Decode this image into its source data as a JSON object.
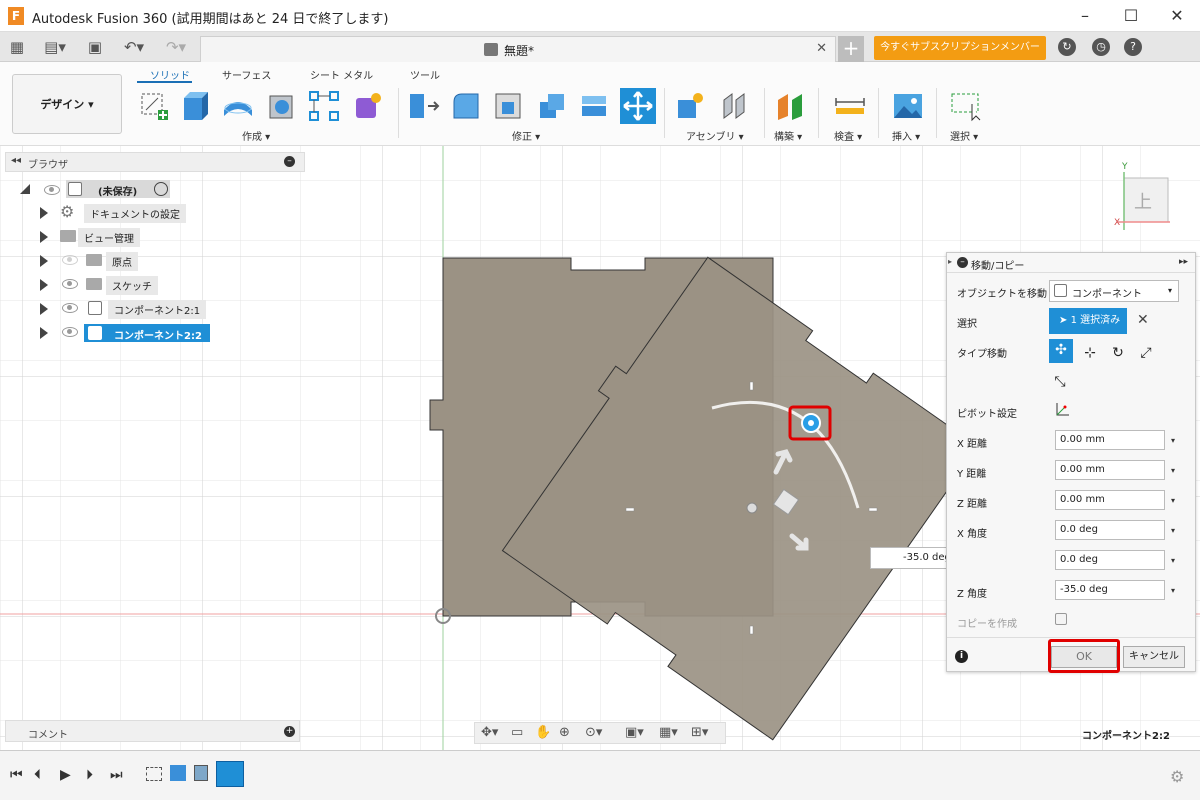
{
  "window": {
    "app_title": "Autodesk Fusion 360 (試用期間はあと 24 日で終了します)",
    "logo_letter": "F"
  },
  "tab": {
    "doc_name": "無題*"
  },
  "subscribe": {
    "label": "今すぐサブスクリプションメンバーに..."
  },
  "toolbar": {
    "workspace": "デザイン ▾",
    "tabs": [
      "ソリッド",
      "サーフェス",
      "シート メタル",
      "ツール"
    ],
    "groups": {
      "create": "作成 ▾",
      "modify": "修正 ▾",
      "assembly": "アセンブリ ▾",
      "construct": "構築 ▾",
      "inspect": "検査 ▾",
      "insert": "挿入 ▾",
      "select": "選択 ▾"
    }
  },
  "browser": {
    "title": "ブラウザ",
    "root": "(未保存)",
    "items": [
      "ドキュメントの設定",
      "ビュー管理",
      "原点",
      "スケッチ",
      "コンポーネント2:1",
      "コンポーネント2:2"
    ]
  },
  "viewcube": {
    "label": "上",
    "axis_y": "Y",
    "axis_x": "X"
  },
  "comment": {
    "label": "コメント"
  },
  "status": {
    "selected_name": "コンポーネント2:2"
  },
  "dialog": {
    "title": "移動/コピー",
    "object_label": "オブジェクトを移動",
    "object_value": "コンポーネント",
    "select_label": "選択",
    "select_value": "1 選択済み",
    "type_label": "タイプ移動",
    "pivot_label": "ピボット設定",
    "x_dist_label": "X 距離",
    "x_dist": "0.00 mm",
    "y_dist_label": "Y 距離",
    "y_dist": "0.00 mm",
    "z_dist_label": "Z 距離",
    "z_dist": "0.00 mm",
    "x_angle_label": "X 角度",
    "x_angle": "0.0 deg",
    "y_angle": "0.0 deg",
    "z_angle_label": "Z 角度",
    "z_angle": "-35.0 deg",
    "copy_label": "コピーを作成",
    "ok": "OK",
    "cancel": "キャンセル"
  },
  "canvas": {
    "angle_input": "-35.0 deg"
  },
  "colors": {
    "accent": "#1f8fd6",
    "highlight": "#e00000",
    "body": "#9b9284",
    "subscribe": "#f39c12"
  }
}
